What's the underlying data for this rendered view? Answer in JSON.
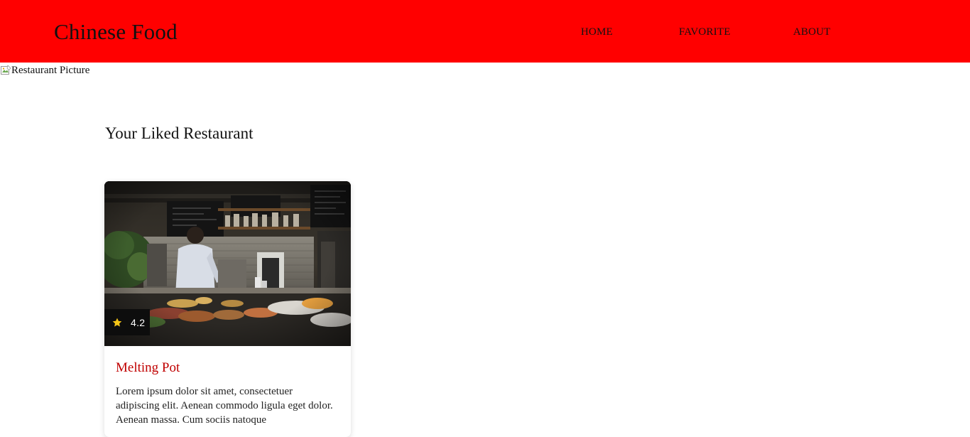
{
  "header": {
    "brand": "Chinese Food",
    "nav": {
      "home": "HOME",
      "favorite": "FAVORITE",
      "about": "ABOUT"
    },
    "background_color": "#ff0000"
  },
  "hero": {
    "alt_text": "Restaurant Picture"
  },
  "section": {
    "title": "Your Liked Restaurant"
  },
  "cards": [
    {
      "rating": "4.2",
      "rating_icon": "star-icon",
      "name": "Melting Pot",
      "description": "Lorem ipsum dolor sit amet, consectetuer adipiscing elit. Aenean commodo ligula eget dolor. Aenean massa. Cum sociis natoque",
      "title_color": "#c00000",
      "star_color": "#f5c518"
    }
  ]
}
